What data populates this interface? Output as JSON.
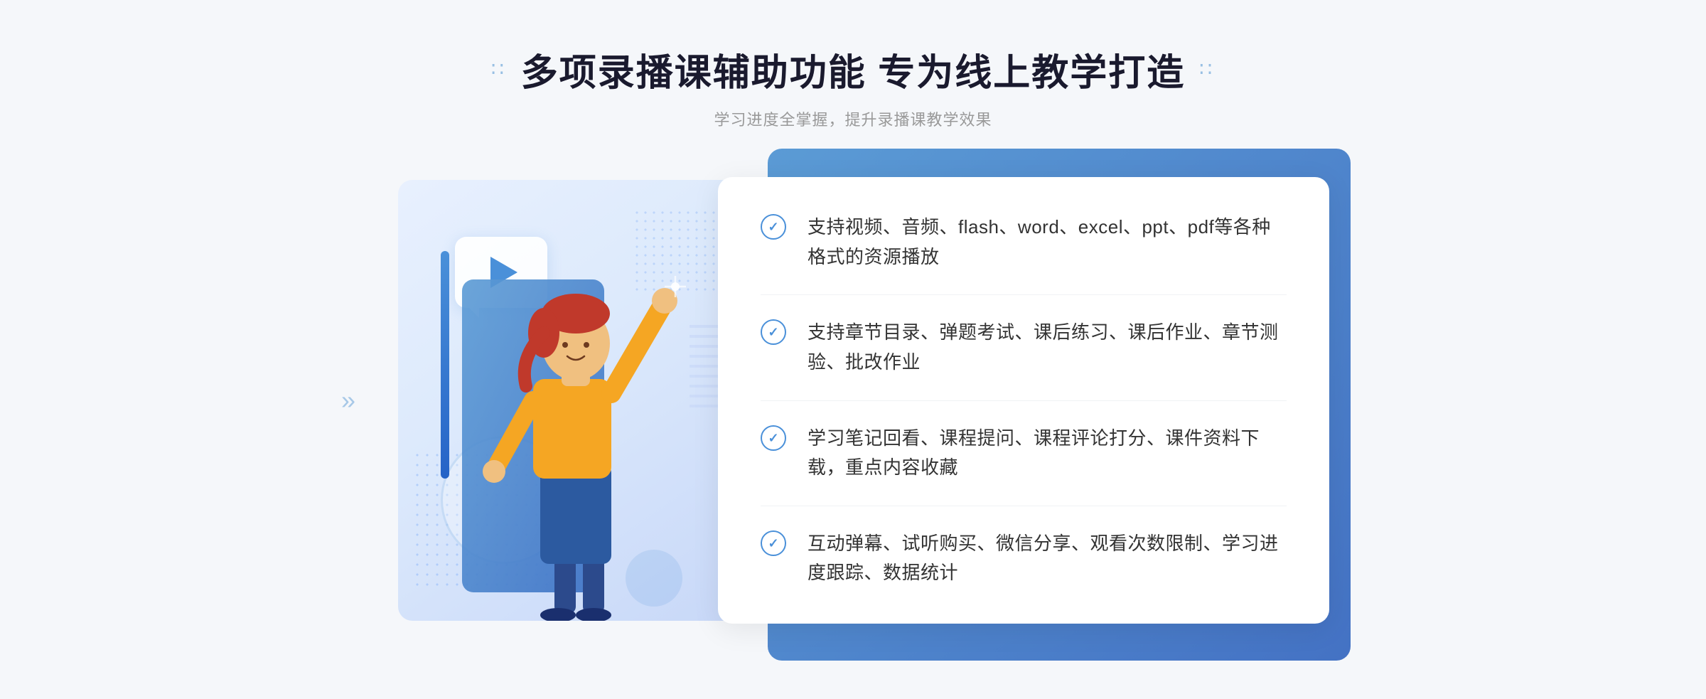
{
  "header": {
    "title": "多项录播课辅助功能 专为线上教学打造",
    "subtitle": "学习进度全掌握，提升录播课教学效果",
    "left_dots": "⠿⠿",
    "right_dots": "⠿⠿"
  },
  "features": [
    {
      "id": 1,
      "text": "支持视频、音频、flash、word、excel、ppt、pdf等各种格式的资源播放"
    },
    {
      "id": 2,
      "text": "支持章节目录、弹题考试、课后练习、课后作业、章节测验、批改作业"
    },
    {
      "id": 3,
      "text": "学习笔记回看、课程提问、课程评论打分、课件资料下载，重点内容收藏"
    },
    {
      "id": 4,
      "text": "互动弹幕、试听购买、微信分享、观看次数限制、学习进度跟踪、数据统计"
    }
  ]
}
